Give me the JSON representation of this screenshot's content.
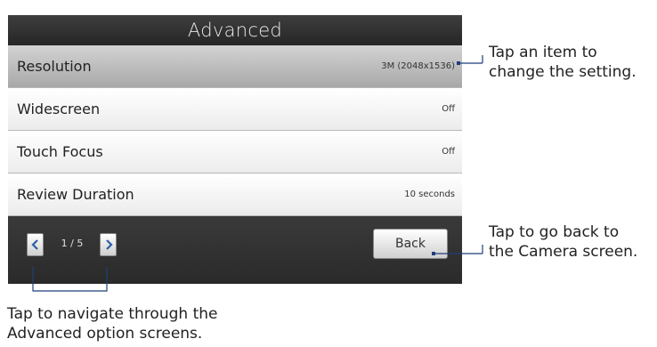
{
  "screen": {
    "title": "Advanced",
    "rows": [
      {
        "label": "Resolution",
        "value": "3M (2048x1536)",
        "selected": true
      },
      {
        "label": "Widescreen",
        "value": "Off",
        "selected": false
      },
      {
        "label": "Touch Focus",
        "value": "Off",
        "selected": false
      },
      {
        "label": "Review Duration",
        "value": "10 seconds",
        "selected": false
      }
    ],
    "footer": {
      "page_indicator": "1 / 5",
      "back_label": "Back",
      "prev_icon": "chevron-left-icon",
      "next_icon": "chevron-right-icon"
    }
  },
  "callouts": {
    "item": {
      "line1": "Tap an item to",
      "line2": "change the setting."
    },
    "back": {
      "line1": "Tap to go back to",
      "line2": "the Camera screen."
    },
    "navigate": {
      "line1": "Tap to navigate through the",
      "line2": "Advanced option screens."
    }
  },
  "colors": {
    "accent_line": "#1f3f7a",
    "title_bar": "#2e2e2e",
    "selected_row": "#b8b8b8"
  }
}
